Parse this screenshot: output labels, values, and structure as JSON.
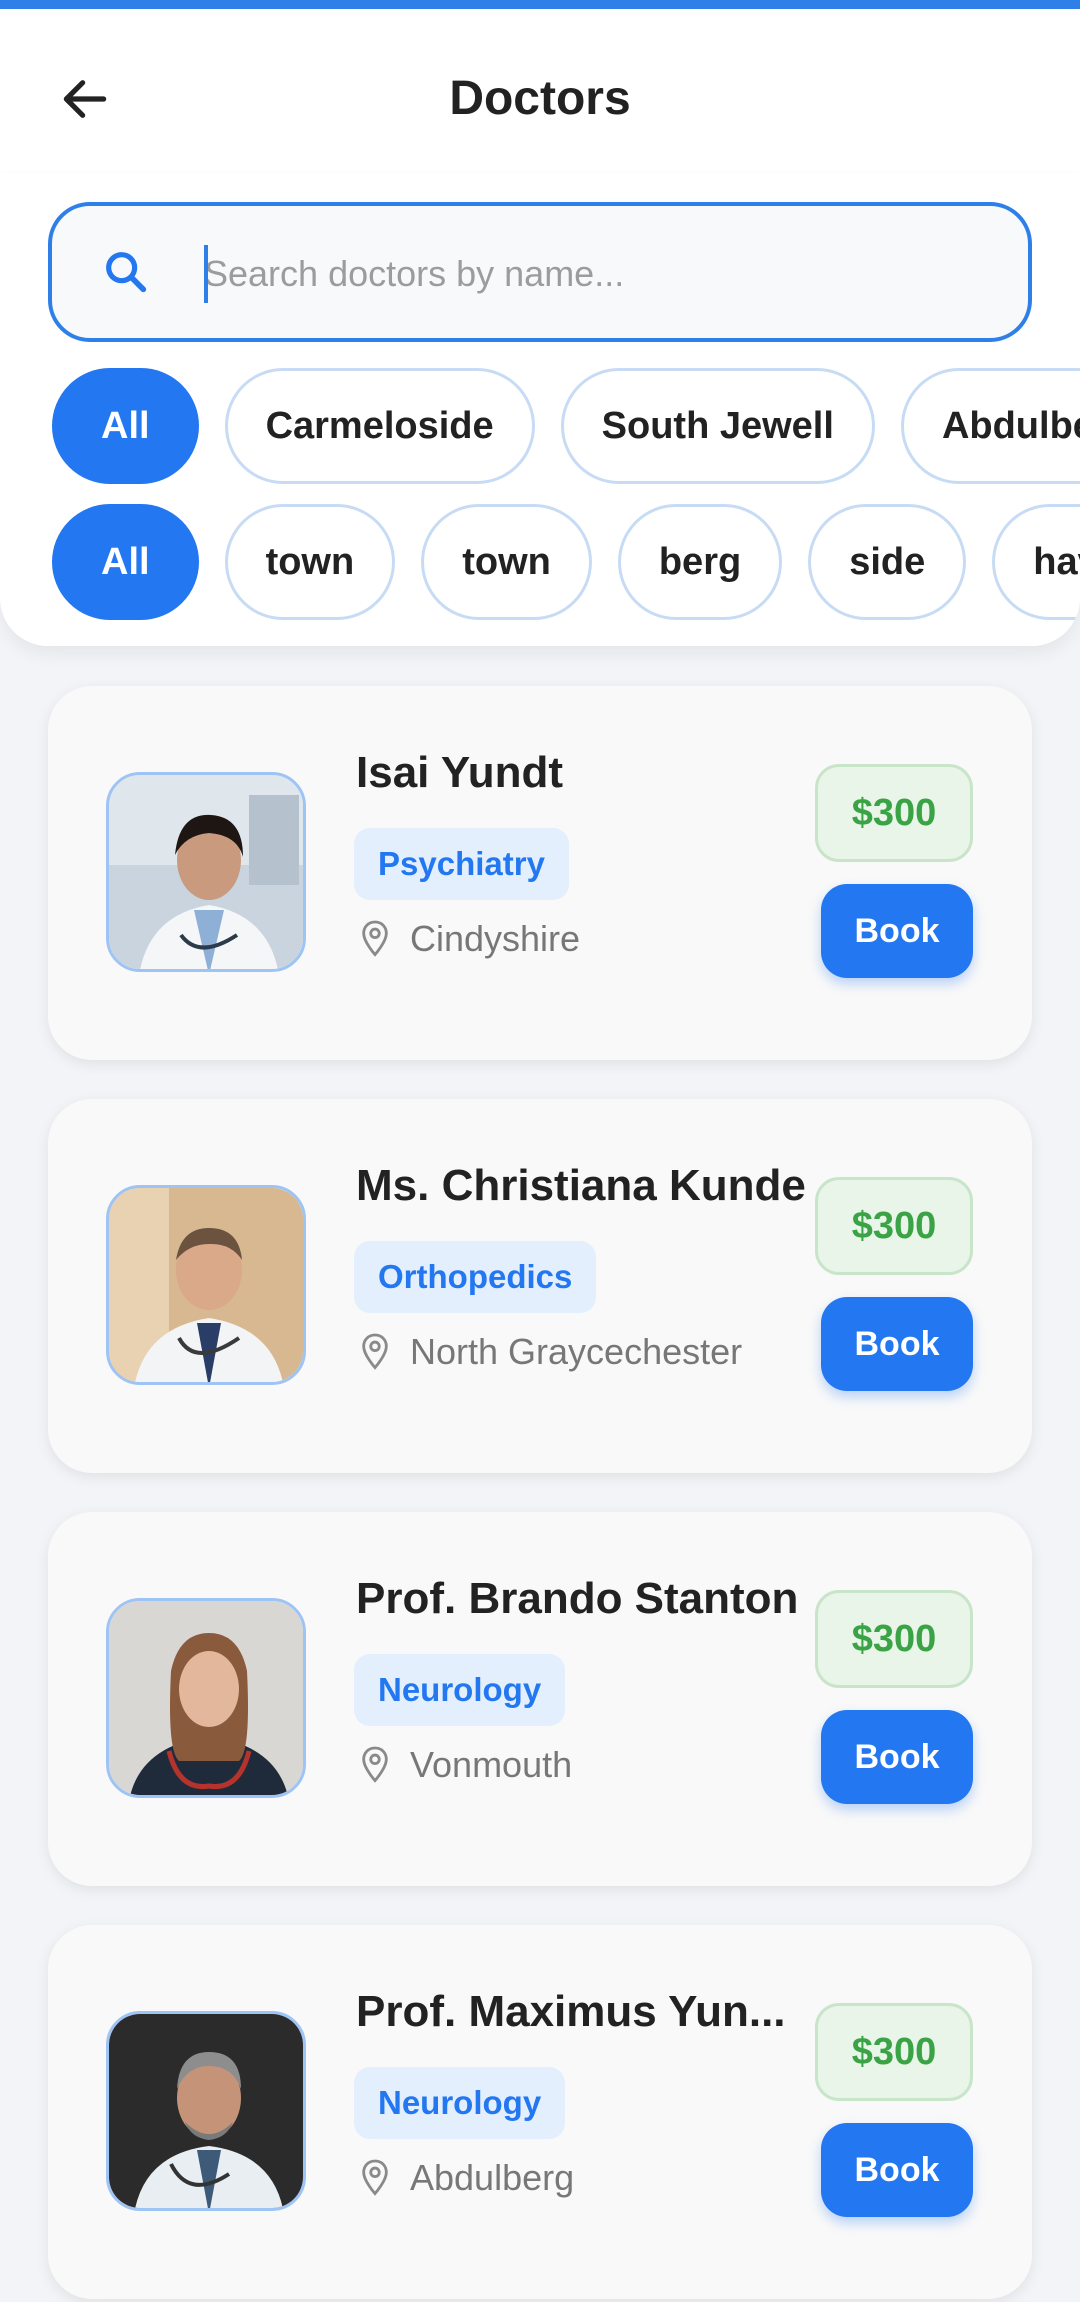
{
  "header": {
    "title": "Doctors"
  },
  "search": {
    "placeholder": "Search doctors by name..."
  },
  "location_filters": [
    "All",
    "Carmeloside",
    "South Jewell",
    "Abdulbe"
  ],
  "suffix_filters": [
    "All",
    "town",
    "town",
    "berg",
    "side",
    "have"
  ],
  "doctors": [
    {
      "name": "Isai Yundt",
      "specialty": "Psychiatry",
      "location": "Cindyshire",
      "price": "$300",
      "book_label": "Book"
    },
    {
      "name": "Ms. Christiana Kunde",
      "specialty": "Orthopedics",
      "location": "North Graycechester",
      "price": "$300",
      "book_label": "Book"
    },
    {
      "name": "Prof. Brando Stanton",
      "specialty": "Neurology",
      "location": "Vonmouth",
      "price": "$300",
      "book_label": "Book"
    },
    {
      "name": "Prof. Maximus Yun...",
      "specialty": "Neurology",
      "location": "Abdulberg",
      "price": "$300",
      "book_label": "Book"
    }
  ],
  "colors": {
    "accent": "#2377f1",
    "price_green": "#3aa346",
    "badge_bg": "#e3effd"
  },
  "icons": {
    "back": "arrow-left-icon",
    "search": "search-icon",
    "location": "map-pin-icon"
  }
}
